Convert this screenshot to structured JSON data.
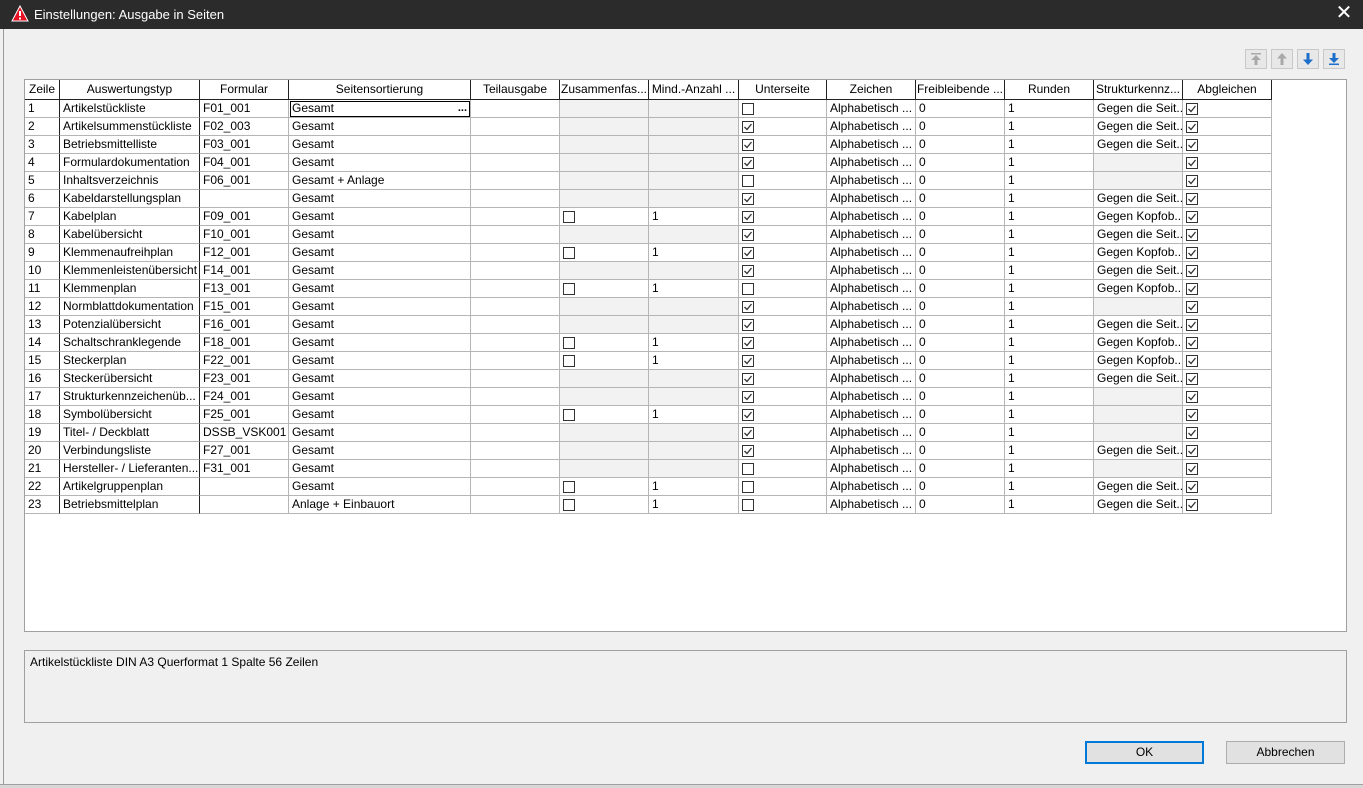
{
  "window": {
    "title": "Einstellungen: Ausgabe in Seiten",
    "close_glyph": "✕",
    "app_icon": "warning-triangle-icon"
  },
  "nav_buttons": [
    "move-top-icon",
    "move-up-icon",
    "move-down-icon",
    "move-bottom-icon"
  ],
  "columns": [
    "Zeile",
    "Auswertungstyp",
    "Formular",
    "Seitensortierung",
    "Teilausgabe",
    "Zusammenfas...",
    "Mind.-Anzahl ...",
    "Unterseite",
    "Zeichen",
    "Freibleibende ...",
    "Runden",
    "Strukturkennz...",
    "Abgleichen"
  ],
  "rows": [
    {
      "n": "1",
      "typ": "Artikelstückliste",
      "form": "F01_001",
      "sort": "Gesamt",
      "zus": null,
      "mind": "",
      "unter": false,
      "zeichen": "Alphabetisch ...",
      "frei": "0",
      "runden": "1",
      "struk": "Gegen die Seit...",
      "abgl": true
    },
    {
      "n": "2",
      "typ": "Artikelsummenstückliste",
      "form": "F02_003",
      "sort": "Gesamt",
      "zus": null,
      "mind": "",
      "unter": true,
      "zeichen": "Alphabetisch ...",
      "frei": "0",
      "runden": "1",
      "struk": "Gegen die Seit...",
      "abgl": true
    },
    {
      "n": "3",
      "typ": "Betriebsmittelliste",
      "form": "F03_001",
      "sort": "Gesamt",
      "zus": null,
      "mind": "",
      "unter": true,
      "zeichen": "Alphabetisch ...",
      "frei": "0",
      "runden": "1",
      "struk": "Gegen die Seit...",
      "abgl": true
    },
    {
      "n": "4",
      "typ": "Formulardokumentation",
      "form": "F04_001",
      "sort": "Gesamt",
      "zus": null,
      "mind": "",
      "unter": true,
      "zeichen": "Alphabetisch ...",
      "frei": "0",
      "runden": "1",
      "struk": "",
      "abgl": true
    },
    {
      "n": "5",
      "typ": "Inhaltsverzeichnis",
      "form": "F06_001",
      "sort": "Gesamt + Anlage",
      "zus": null,
      "mind": "",
      "unter": false,
      "zeichen": "Alphabetisch ...",
      "frei": "0",
      "runden": "1",
      "struk": "",
      "abgl": true
    },
    {
      "n": "6",
      "typ": "Kabeldarstellungsplan",
      "form": "",
      "sort": "Gesamt",
      "zus": null,
      "mind": "",
      "unter": true,
      "zeichen": "Alphabetisch ...",
      "frei": "0",
      "runden": "1",
      "struk": "Gegen die Seit...",
      "abgl": true
    },
    {
      "n": "7",
      "typ": "Kabelplan",
      "form": "F09_001",
      "sort": "Gesamt",
      "zus": false,
      "mind": "1",
      "unter": true,
      "zeichen": "Alphabetisch ...",
      "frei": "0",
      "runden": "1",
      "struk": "Gegen Kopfob...",
      "abgl": true
    },
    {
      "n": "8",
      "typ": "Kabelübersicht",
      "form": "F10_001",
      "sort": "Gesamt",
      "zus": null,
      "mind": "",
      "unter": true,
      "zeichen": "Alphabetisch ...",
      "frei": "0",
      "runden": "1",
      "struk": "Gegen die Seit...",
      "abgl": true
    },
    {
      "n": "9",
      "typ": "Klemmenaufreihplan",
      "form": "F12_001",
      "sort": "Gesamt",
      "zus": false,
      "mind": "1",
      "unter": true,
      "zeichen": "Alphabetisch ...",
      "frei": "0",
      "runden": "1",
      "struk": "Gegen Kopfob...",
      "abgl": true
    },
    {
      "n": "10",
      "typ": "Klemmenleistenübersicht",
      "form": "F14_001",
      "sort": "Gesamt",
      "zus": null,
      "mind": "",
      "unter": true,
      "zeichen": "Alphabetisch ...",
      "frei": "0",
      "runden": "1",
      "struk": "Gegen die Seit...",
      "abgl": true
    },
    {
      "n": "11",
      "typ": "Klemmenplan",
      "form": "F13_001",
      "sort": "Gesamt",
      "zus": false,
      "mind": "1",
      "unter": false,
      "zeichen": "Alphabetisch ...",
      "frei": "0",
      "runden": "1",
      "struk": "Gegen Kopfob...",
      "abgl": true
    },
    {
      "n": "12",
      "typ": "Normblattdokumentation",
      "form": "F15_001",
      "sort": "Gesamt",
      "zus": null,
      "mind": "",
      "unter": true,
      "zeichen": "Alphabetisch ...",
      "frei": "0",
      "runden": "1",
      "struk": "",
      "abgl": true
    },
    {
      "n": "13",
      "typ": "Potenzialübersicht",
      "form": "F16_001",
      "sort": "Gesamt",
      "zus": null,
      "mind": "",
      "unter": true,
      "zeichen": "Alphabetisch ...",
      "frei": "0",
      "runden": "1",
      "struk": "Gegen die Seit...",
      "abgl": true
    },
    {
      "n": "14",
      "typ": "Schaltschranklegende",
      "form": "F18_001",
      "sort": "Gesamt",
      "zus": false,
      "mind": "1",
      "unter": true,
      "zeichen": "Alphabetisch ...",
      "frei": "0",
      "runden": "1",
      "struk": "Gegen Kopfob...",
      "abgl": true
    },
    {
      "n": "15",
      "typ": "Steckerplan",
      "form": "F22_001",
      "sort": "Gesamt",
      "zus": false,
      "mind": "1",
      "unter": true,
      "zeichen": "Alphabetisch ...",
      "frei": "0",
      "runden": "1",
      "struk": "Gegen Kopfob...",
      "abgl": true
    },
    {
      "n": "16",
      "typ": "Steckerübersicht",
      "form": "F23_001",
      "sort": "Gesamt",
      "zus": null,
      "mind": "",
      "unter": true,
      "zeichen": "Alphabetisch ...",
      "frei": "0",
      "runden": "1",
      "struk": "Gegen die Seit...",
      "abgl": true
    },
    {
      "n": "17",
      "typ": "Strukturkennzeichenüb...",
      "form": "F24_001",
      "sort": "Gesamt",
      "zus": null,
      "mind": "",
      "unter": true,
      "zeichen": "Alphabetisch ...",
      "frei": "0",
      "runden": "1",
      "struk": "",
      "abgl": true
    },
    {
      "n": "18",
      "typ": "Symbolübersicht",
      "form": "F25_001",
      "sort": "Gesamt",
      "zus": false,
      "mind": "1",
      "unter": true,
      "zeichen": "Alphabetisch ...",
      "frei": "0",
      "runden": "1",
      "struk": "",
      "abgl": true
    },
    {
      "n": "19",
      "typ": "Titel- / Deckblatt",
      "form": "DSSB_VSK001",
      "sort": "Gesamt",
      "zus": null,
      "mind": "",
      "unter": true,
      "zeichen": "Alphabetisch ...",
      "frei": "0",
      "runden": "1",
      "struk": "",
      "abgl": true
    },
    {
      "n": "20",
      "typ": "Verbindungsliste",
      "form": "F27_001",
      "sort": "Gesamt",
      "zus": null,
      "mind": "",
      "unter": true,
      "zeichen": "Alphabetisch ...",
      "frei": "0",
      "runden": "1",
      "struk": "Gegen die Seit...",
      "abgl": true
    },
    {
      "n": "21",
      "typ": "Hersteller- / Lieferanten...",
      "form": "F31_001",
      "sort": "Gesamt",
      "zus": null,
      "mind": "",
      "unter": false,
      "zeichen": "Alphabetisch ...",
      "frei": "0",
      "runden": "1",
      "struk": "",
      "abgl": true
    },
    {
      "n": "22",
      "typ": "Artikelgruppenplan",
      "form": "",
      "sort": "Gesamt",
      "zus": false,
      "mind": "1",
      "unter": false,
      "zeichen": "Alphabetisch ...",
      "frei": "0",
      "runden": "1",
      "struk": "Gegen die Seit...",
      "abgl": true
    },
    {
      "n": "23",
      "typ": "Betriebsmittelplan",
      "form": "",
      "sort": "Anlage + Einbauort",
      "zus": false,
      "mind": "1",
      "unter": false,
      "zeichen": "Alphabetisch ...",
      "frei": "0",
      "runden": "1",
      "struk": "Gegen die Seit...",
      "abgl": true
    }
  ],
  "selected_cell_ellipsis": "...",
  "description": "Artikelstückliste DIN A3 Querformat 1 Spalte 56 Zeilen",
  "buttons": {
    "ok": "OK",
    "cancel": "Abbrechen"
  }
}
